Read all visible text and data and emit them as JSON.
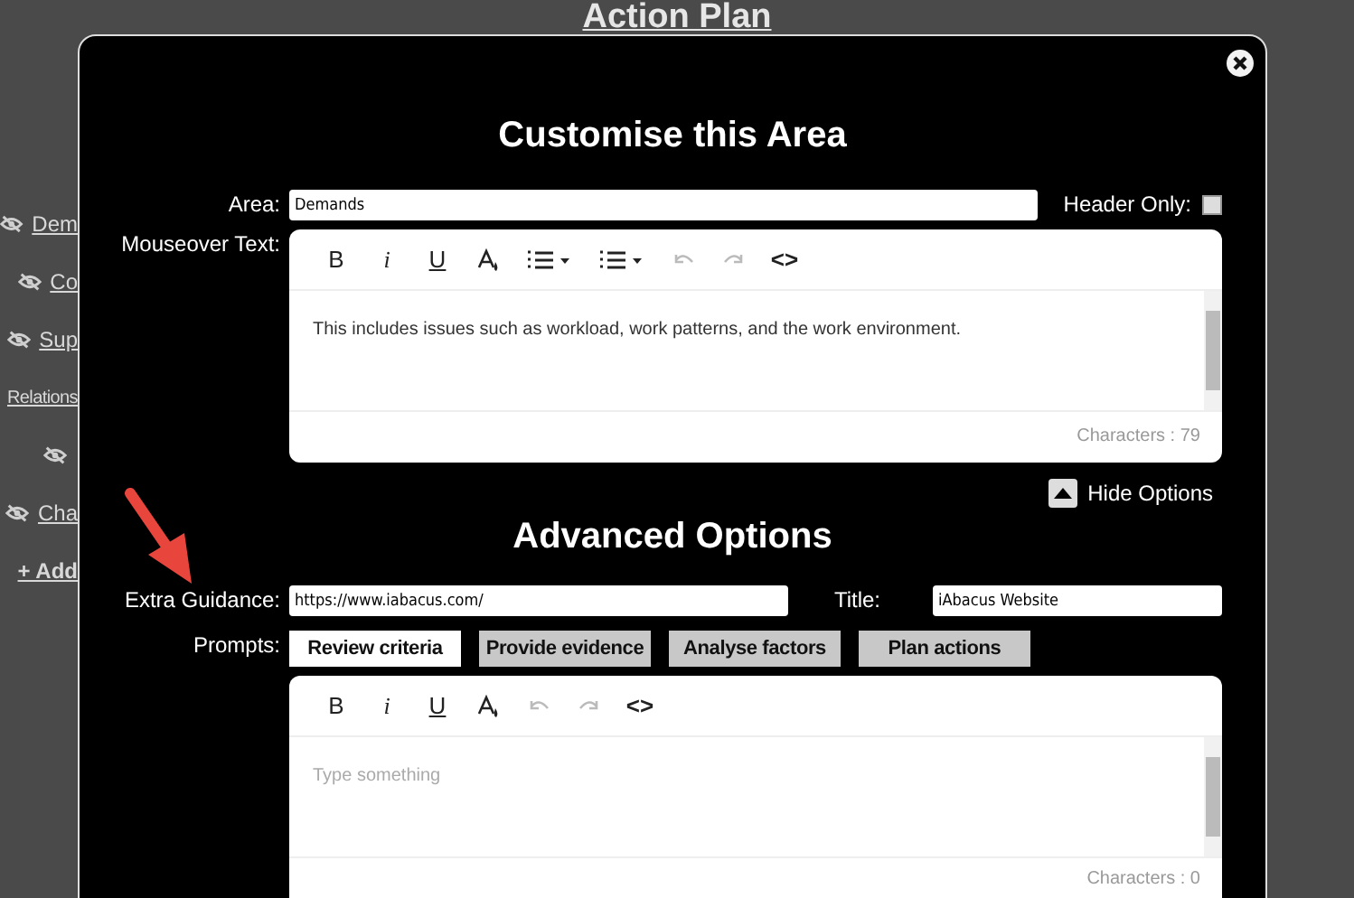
{
  "page": {
    "title": "Action Plan",
    "sidebar": [
      {
        "kind": "toggle",
        "label": "Dem"
      },
      {
        "kind": "toggle",
        "label": "Co"
      },
      {
        "kind": "toggle",
        "label": "Sup"
      },
      {
        "kind": "heading",
        "label": "Relations"
      },
      {
        "kind": "toggle"
      },
      {
        "kind": "toggle",
        "label": "Cha"
      },
      {
        "kind": "add",
        "label": "+ Add"
      }
    ]
  },
  "dialog": {
    "title": "Customise this Area",
    "area": {
      "label": "Area:",
      "value": "Demands"
    },
    "header_only": {
      "label": "Header Only:",
      "checked": false
    },
    "mouseover": {
      "label": "Mouseover Text:",
      "toolbar": [
        {
          "kind": "bold",
          "label": "B",
          "disabled": false
        },
        {
          "kind": "italic",
          "label": "i",
          "disabled": false
        },
        {
          "kind": "underline",
          "label": "U",
          "disabled": false
        },
        {
          "kind": "color",
          "disabled": false
        },
        {
          "kind": "ol",
          "disabled": false
        },
        {
          "kind": "ul",
          "disabled": false
        },
        {
          "kind": "undo",
          "disabled": true
        },
        {
          "kind": "redo",
          "disabled": true
        },
        {
          "kind": "code",
          "label": "<>",
          "disabled": false
        }
      ],
      "text": "This includes issues such as workload, work patterns, and the work environment.",
      "count": "Characters : 79"
    },
    "options_toggle": {
      "label": "Hide Options",
      "expanded": true
    },
    "advanced_title": "Advanced Options",
    "extra_guidance": {
      "label": "Extra Guidance:",
      "value": "https://www.iabacus.com/"
    },
    "title_field": {
      "label": "Title:",
      "value": "iAbacus Website"
    },
    "prompts": {
      "label": "Prompts:",
      "tabs": [
        {
          "label": "Review criteria",
          "selected": true
        },
        {
          "label": "Provide evidence",
          "selected": false
        },
        {
          "label": "Analyse factors",
          "selected": false
        },
        {
          "label": "Plan actions",
          "selected": false
        }
      ],
      "toolbar": [
        {
          "kind": "bold",
          "label": "B",
          "disabled": false
        },
        {
          "kind": "italic",
          "label": "i",
          "disabled": false
        },
        {
          "kind": "underline",
          "label": "U",
          "disabled": false
        },
        {
          "kind": "color",
          "disabled": false
        },
        {
          "kind": "undo",
          "disabled": true
        },
        {
          "kind": "redo",
          "disabled": true
        },
        {
          "kind": "code",
          "label": "<>",
          "disabled": false
        }
      ],
      "placeholder": "Type something",
      "count": "Characters : 0"
    }
  }
}
